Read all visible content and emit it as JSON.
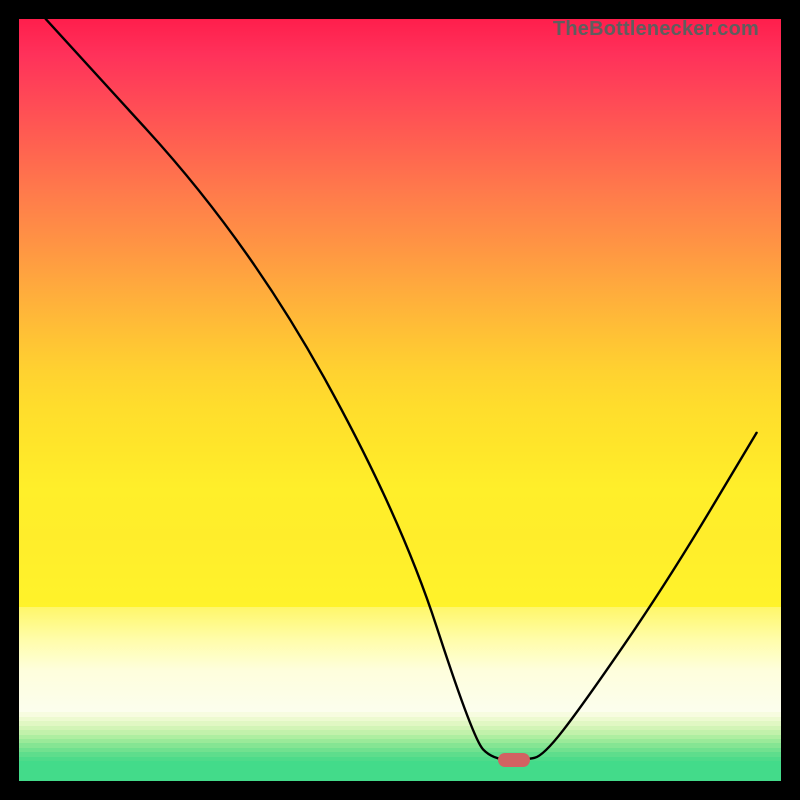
{
  "watermark": "TheBottlenecker.com",
  "marker": {
    "x_pct": 65.0,
    "y_pct": 97.2
  },
  "green_stripe_colors": [
    "#f7fce0",
    "#edfad1",
    "#e1f7c3",
    "#d2f4b6",
    "#c2f1ab",
    "#aeeea1",
    "#9aea99",
    "#85e593",
    "#71e18f",
    "#5edd8c",
    "#4edb8a",
    "#43db8a"
  ],
  "chart_data": {
    "type": "line",
    "title": "",
    "xlabel": "",
    "ylabel": "",
    "xlim": [
      0,
      100
    ],
    "ylim": [
      0,
      100
    ],
    "series": [
      {
        "name": "bottleneck-curve",
        "points": [
          {
            "x": 3.5,
            "y": 100.0
          },
          {
            "x": 30.0,
            "y": 71.0
          },
          {
            "x": 50.0,
            "y": 35.0
          },
          {
            "x": 59.6,
            "y": 5.5
          },
          {
            "x": 62.2,
            "y": 2.8
          },
          {
            "x": 66.5,
            "y": 2.8
          },
          {
            "x": 68.8,
            "y": 3.3
          },
          {
            "x": 74.0,
            "y": 10.0
          },
          {
            "x": 85.0,
            "y": 26.0
          },
          {
            "x": 96.8,
            "y": 45.7
          }
        ]
      }
    ],
    "marker": {
      "x": 65.5,
      "y": 2.8
    },
    "background_gradient_stops": [
      {
        "pct": 0,
        "color": "#ff1e4c"
      },
      {
        "pct": 50,
        "color": "#ffc235"
      },
      {
        "pct": 80,
        "color": "#fff32a"
      },
      {
        "pct": 92,
        "color": "#fefedc"
      },
      {
        "pct": 100,
        "color": "#43db8a"
      }
    ]
  }
}
